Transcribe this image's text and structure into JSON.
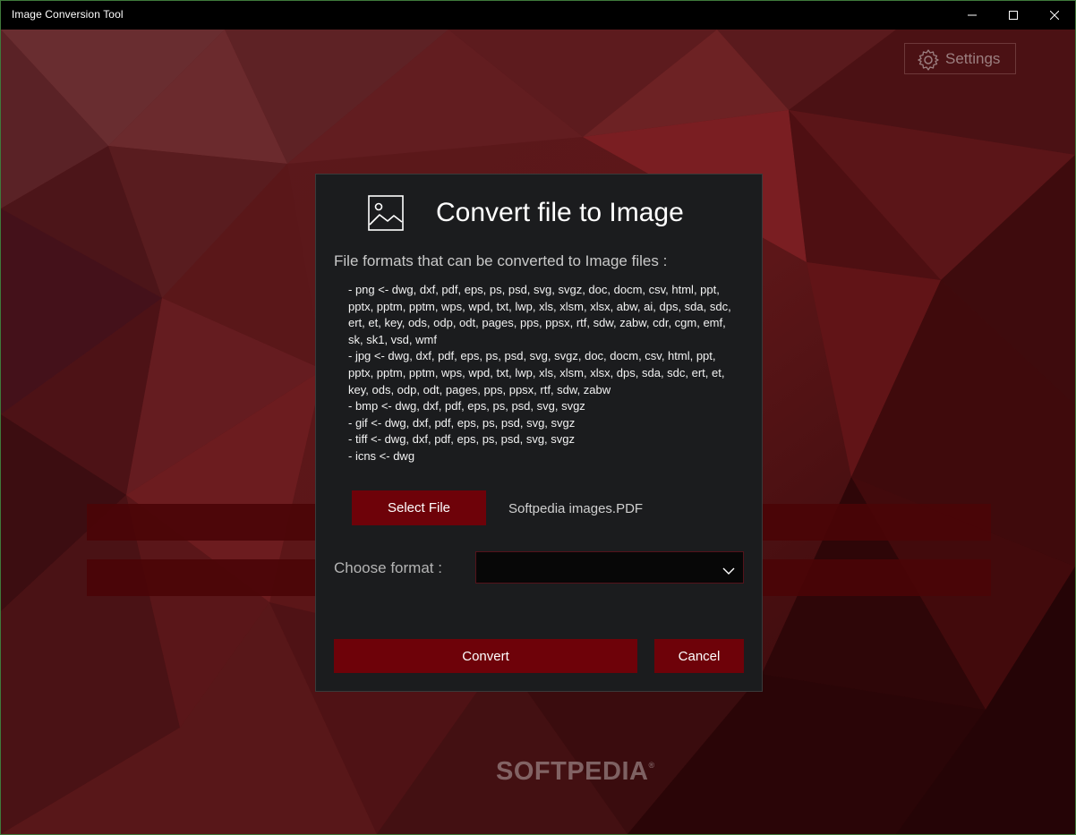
{
  "window": {
    "title": "Image Conversion Tool"
  },
  "header": {
    "settings_label": "Settings",
    "settings_icon": "gear-icon"
  },
  "dialog": {
    "icon": "image-icon",
    "title": "Convert file to Image",
    "subtitle": "File formats that can be converted to Image files :",
    "formats": [
      "- png <- dwg, dxf, pdf, eps, ps, psd, svg, svgz, doc, docm, csv, html, ppt, pptx, pptm, pptm, wps, wpd, txt, lwp, xls, xlsm, xlsx, abw, ai, dps, sda, sdc, ert, et, key, ods, odp, odt, pages, pps, ppsx, rtf, sdw, zabw, cdr, cgm, emf, sk, sk1, vsd, wmf",
      "- jpg <- dwg, dxf, pdf, eps, ps, psd, svg, svgz, doc, docm, csv, html, ppt, pptx, pptm, pptm, wps, wpd, txt, lwp, xls, xlsm, xlsx, dps, sda, sdc, ert, et, key, ods, odp, odt, pages, pps, ppsx, rtf, sdw, zabw",
      "- bmp <- dwg, dxf, pdf, eps, ps, psd, svg, svgz",
      "- gif <- dwg, dxf, pdf, eps, ps, psd, svg, svgz",
      "- tiff <- dwg, dxf, pdf, eps, ps, psd, svg, svgz",
      "- icns <- dwg"
    ],
    "select_file_label": "Select File",
    "selected_file": "Softpedia images.PDF",
    "choose_format_label": "Choose format :",
    "format_value": "",
    "convert_label": "Convert",
    "cancel_label": "Cancel"
  },
  "watermark": {
    "text": "SOFTPEDIA",
    "mark": "®"
  },
  "colors": {
    "accent": "#6e0209",
    "dialog_bg": "#1b1c1e",
    "titlebar_bg": "#000000"
  }
}
